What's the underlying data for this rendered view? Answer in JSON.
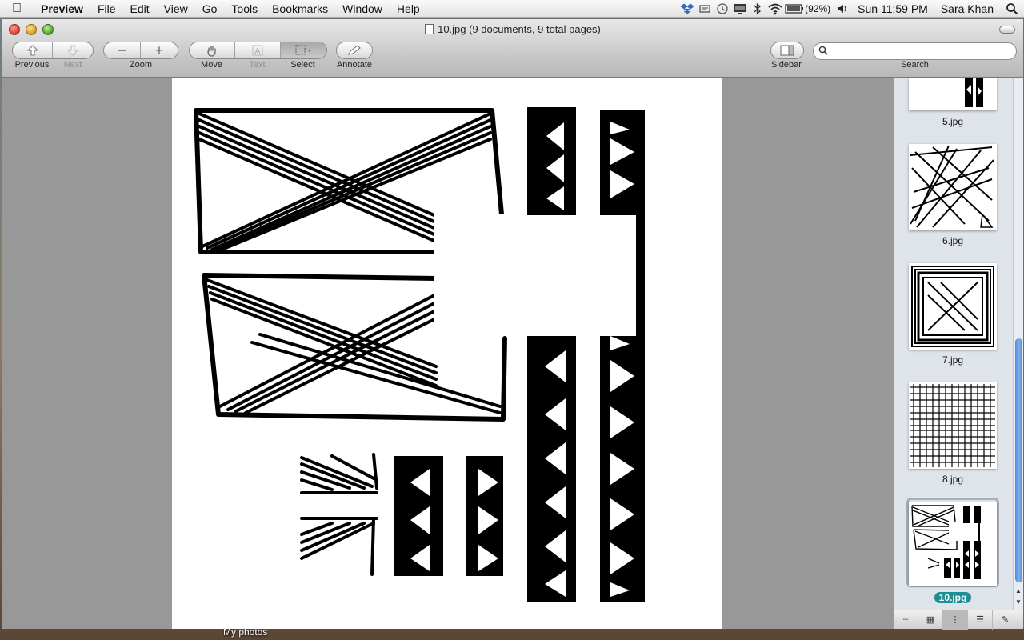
{
  "menubar": {
    "app_name": "Preview",
    "menus": [
      "File",
      "Edit",
      "View",
      "Go",
      "Tools",
      "Bookmarks",
      "Window",
      "Help"
    ],
    "battery_percent": "(92%)",
    "clock": "Sun 11:59 PM",
    "user": "Sara Khan"
  },
  "window": {
    "title": "10.jpg (9 documents, 9 total pages)"
  },
  "toolbar": {
    "previous_label": "Previous",
    "next_label": "Next",
    "zoom_label": "Zoom",
    "move_label": "Move",
    "text_label": "Text",
    "select_label": "Select",
    "annotate_label": "Annotate",
    "sidebar_label": "Sidebar",
    "search_label": "Search",
    "search_placeholder": ""
  },
  "sidebar": {
    "thumbnails": [
      {
        "label": "5.jpg",
        "selected": false
      },
      {
        "label": "6.jpg",
        "selected": false
      },
      {
        "label": "7.jpg",
        "selected": false
      },
      {
        "label": "8.jpg",
        "selected": false
      },
      {
        "label": "10.jpg",
        "selected": true
      }
    ]
  },
  "desktop": {
    "folder_label": "My photos"
  },
  "colors": {
    "selection_badge": "#1c8f96",
    "scroll_knob": "#4d8ad8"
  }
}
